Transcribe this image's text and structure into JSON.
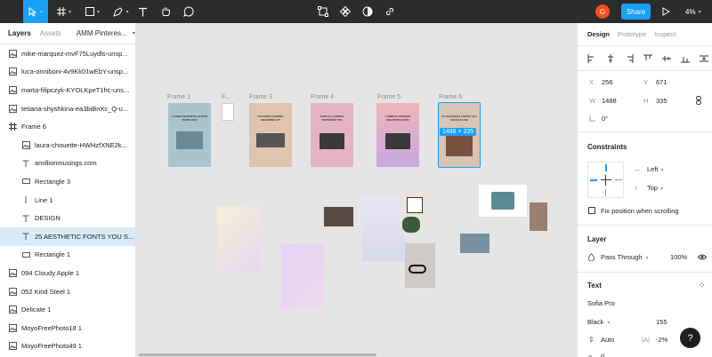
{
  "toolbar": {
    "avatar_letter": "G",
    "share_label": "Share",
    "zoom_label": "4%"
  },
  "left_panel": {
    "tabs": {
      "layers": "Layers",
      "assets": "Assets",
      "page": "AMM Pinteres..."
    },
    "layers": [
      {
        "label": "mike-marquez-mvF75Luydls-unsp...",
        "icon": "image-icon"
      },
      {
        "label": "luca-onniboni-4v9Kk01wEbY-unsp...",
        "icon": "image-icon"
      },
      {
        "label": "marta-filipczyk-KYOLKpeT1hc-uns...",
        "icon": "image-icon"
      },
      {
        "label": "tetiana-shyshkina-ea3biBnXc_Q-u...",
        "icon": "image-icon"
      },
      {
        "label": "Frame 6",
        "icon": "frame-icon"
      },
      {
        "label": "laura-chouette-HWHzfXNE2k...",
        "icon": "image-icon"
      },
      {
        "label": "amillionmusings.com",
        "icon": "text-icon"
      },
      {
        "label": "Rectangle 3",
        "icon": "rectangle-icon"
      },
      {
        "label": "Line 1",
        "icon": "line-icon"
      },
      {
        "label": "DESIGN",
        "icon": "text-icon"
      },
      {
        "label": "25 AESTHETIC FONTS YOU S...",
        "icon": "text-icon"
      },
      {
        "label": "Rectangle 1",
        "icon": "rectangle-icon"
      },
      {
        "label": "094 Cloudy Apple 1",
        "icon": "image-icon"
      },
      {
        "label": "052 Kind Steel 1",
        "icon": "image-icon"
      },
      {
        "label": "Delicate 1",
        "icon": "image-icon"
      },
      {
        "label": "MoyoFreePhoto18 1",
        "icon": "image-icon"
      },
      {
        "label": "MoyoFreePhoto49 1",
        "icon": "image-icon"
      }
    ]
  },
  "canvas": {
    "frames": [
      {
        "label": "Frame 1",
        "title": "A FREE AESTHETIC OUTRO TEMPLATE!",
        "bg": "#a9c4cc"
      },
      {
        "label": "F...",
        "title": "",
        "bg": "#ffffff"
      },
      {
        "label": "Frame 3",
        "title": "YOUTUBE CHANNEL BRANDING KIT",
        "bg": "#e0c4ac"
      },
      {
        "label": "Frame 4",
        "title": "THIS IS A SAMPLE PINTEREST PIN",
        "bg": "#e4b4c4"
      },
      {
        "label": "Frame 5",
        "title": "1 SIMPLE CONTENT CREATION HACK!",
        "bg": "#c8a8e0"
      },
      {
        "label": "Frame 6",
        "title": "25 AESTHETIC FONTS YOU SHOULD USE",
        "bg": "#d8c4b4"
      }
    ],
    "size_badge": "1488 × 335"
  },
  "right_panel": {
    "tabs": {
      "design": "Design",
      "prototype": "Prototype",
      "inspect": "Inspect"
    },
    "x_label": "X",
    "x_value": "256",
    "y_label": "Y",
    "y_value": "671",
    "w_label": "W",
    "w_value": "1488",
    "h_label": "H",
    "h_value": "335",
    "rotation_value": "0°",
    "constraints_title": "Constraints",
    "constraint_h": "Left",
    "constraint_v": "Top",
    "fix_position_label": "Fix position when scrolling",
    "layer_title": "Layer",
    "blend_mode": "Pass Through",
    "opacity": "100%",
    "text_title": "Text",
    "font_family": "Sofia Pro",
    "font_weight": "Black",
    "font_size": "155",
    "line_height": "Auto",
    "letter_spacing": "-2%",
    "paragraph_spacing": "0"
  },
  "colors": {
    "accent": "#18a0fb",
    "toolbar_bg": "#2c2c2c",
    "selection": "#daebf7"
  }
}
